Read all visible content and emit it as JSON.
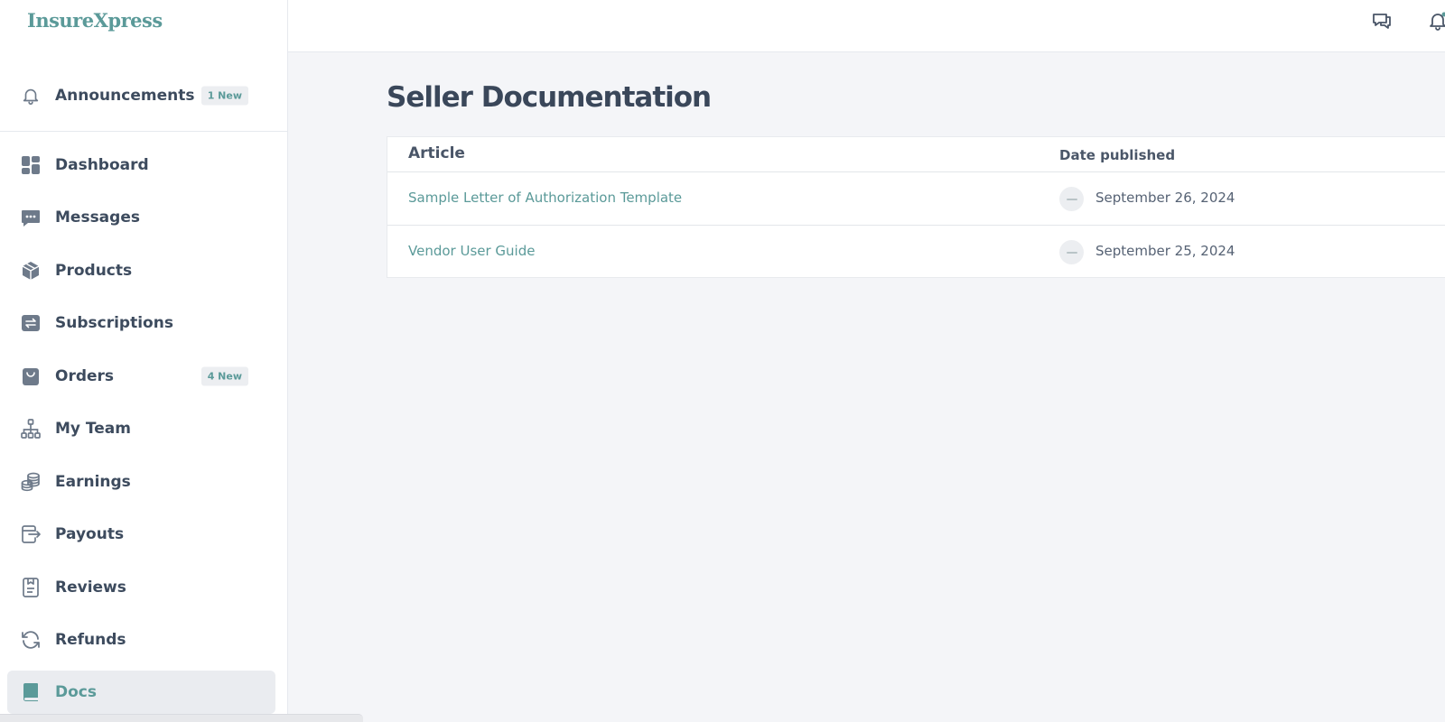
{
  "brand": {
    "logo_text": "InsureXpress",
    "accent_color": "#5b9a99"
  },
  "header": {
    "icons": [
      "chat-icon",
      "notification-bell-icon"
    ]
  },
  "sidebar": {
    "announcements": {
      "label": "Announcements",
      "badge": "1 New",
      "icon": "bell-icon"
    },
    "items": [
      {
        "label": "Dashboard",
        "icon": "dashboard-icon",
        "badge": ""
      },
      {
        "label": "Messages",
        "icon": "message-icon",
        "badge": ""
      },
      {
        "label": "Products",
        "icon": "box-icon",
        "badge": ""
      },
      {
        "label": "Subscriptions",
        "icon": "repeat-icon",
        "badge": ""
      },
      {
        "label": "Orders",
        "icon": "shopping-bag-icon",
        "badge": "4 New"
      },
      {
        "label": "My Team",
        "icon": "org-chart-icon",
        "badge": ""
      },
      {
        "label": "Earnings",
        "icon": "coins-icon",
        "badge": ""
      },
      {
        "label": "Payouts",
        "icon": "payout-icon",
        "badge": ""
      },
      {
        "label": "Reviews",
        "icon": "review-icon",
        "badge": ""
      },
      {
        "label": "Refunds",
        "icon": "refresh-icon",
        "badge": ""
      },
      {
        "label": "Docs",
        "icon": "book-icon",
        "badge": "",
        "active": true
      }
    ]
  },
  "main": {
    "title": "Seller Documentation",
    "table": {
      "columns": [
        "Article",
        "Date published"
      ],
      "rows": [
        {
          "article": "Sample Letter of Authorization Template",
          "date": "September 26, 2024"
        },
        {
          "article": "Vendor User Guide",
          "date": "September 25, 2024"
        }
      ]
    }
  }
}
